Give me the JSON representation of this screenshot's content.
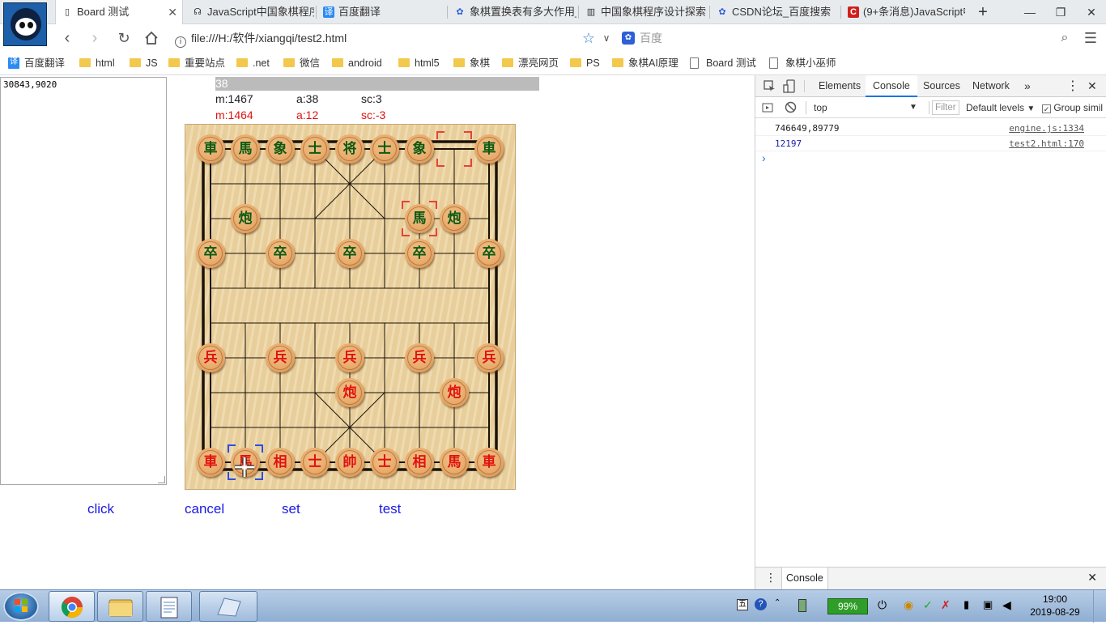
{
  "browser": {
    "tabs": [
      {
        "label": "Board 测试",
        "icon": "doc-icon",
        "active": true
      },
      {
        "label": "JavaScript中国象棋程序",
        "icon": "code-icon"
      },
      {
        "label": "百度翻译",
        "icon": "translate-icon"
      },
      {
        "label": "象棋置换表有多大作用_",
        "icon": "baidu-paw-icon"
      },
      {
        "label": "中国象棋程序设计探索",
        "icon": "book-icon"
      },
      {
        "label": "CSDN论坛_百度搜索",
        "icon": "baidu-paw-icon"
      },
      {
        "label": "(9+条消息)JavaScript中",
        "icon": "csdn-icon"
      }
    ],
    "new_tab": "+",
    "window_controls": {
      "minimize": "—",
      "maximize": "❐",
      "close": "✕"
    },
    "url": "file:///H:/软件/xiangqi/test2.html",
    "search_placeholder": "百度",
    "bookmarks": [
      {
        "label": "百度翻译",
        "icon": "translate-icon"
      },
      {
        "label": "html",
        "icon": "folder-icon"
      },
      {
        "label": "JS",
        "icon": "folder-icon"
      },
      {
        "label": "重要站点",
        "icon": "folder-icon"
      },
      {
        "label": ".net",
        "icon": "folder-icon"
      },
      {
        "label": "微信",
        "icon": "folder-icon"
      },
      {
        "label": "android",
        "icon": "folder-icon"
      },
      {
        "label": "html5",
        "icon": "folder-icon"
      },
      {
        "label": "象棋",
        "icon": "folder-icon"
      },
      {
        "label": "漂亮网页",
        "icon": "folder-icon"
      },
      {
        "label": "PS",
        "icon": "folder-icon"
      },
      {
        "label": "象棋AI原理",
        "icon": "folder-icon"
      },
      {
        "label": "Board 测试",
        "icon": "doc-icon"
      },
      {
        "label": "象棋小巫师",
        "icon": "doc-icon"
      }
    ]
  },
  "page": {
    "textarea_value": "30843,9020",
    "progress_label": "38",
    "stats_black": {
      "m": "m:1467",
      "a": "a:38",
      "sc": "sc:3"
    },
    "stats_red": {
      "m": "m:1464",
      "a": "a:12",
      "sc": "sc:-3"
    },
    "colors": {
      "red": "#e0120e",
      "black": "#0d5a12",
      "link": "#1a1ae6",
      "board": "#ecd3a0"
    },
    "links": [
      "click",
      "cancel",
      "set",
      "test"
    ],
    "pieces": [
      {
        "ch": "車",
        "side": "black",
        "col": 0,
        "row": 0
      },
      {
        "ch": "馬",
        "side": "black",
        "col": 1,
        "row": 0
      },
      {
        "ch": "象",
        "side": "black",
        "col": 2,
        "row": 0
      },
      {
        "ch": "士",
        "side": "black",
        "col": 3,
        "row": 0
      },
      {
        "ch": "将",
        "side": "black",
        "col": 4,
        "row": 0
      },
      {
        "ch": "士",
        "side": "black",
        "col": 5,
        "row": 0
      },
      {
        "ch": "象",
        "side": "black",
        "col": 6,
        "row": 0
      },
      {
        "ch": "車",
        "side": "black",
        "col": 8,
        "row": 0
      },
      {
        "ch": "炮",
        "side": "black",
        "col": 1,
        "row": 2
      },
      {
        "ch": "馬",
        "side": "black",
        "col": 6,
        "row": 2
      },
      {
        "ch": "炮",
        "side": "black",
        "col": 7,
        "row": 2
      },
      {
        "ch": "卒",
        "side": "black",
        "col": 0,
        "row": 3
      },
      {
        "ch": "卒",
        "side": "black",
        "col": 2,
        "row": 3
      },
      {
        "ch": "卒",
        "side": "black",
        "col": 4,
        "row": 3
      },
      {
        "ch": "卒",
        "side": "black",
        "col": 6,
        "row": 3
      },
      {
        "ch": "卒",
        "side": "black",
        "col": 8,
        "row": 3
      },
      {
        "ch": "兵",
        "side": "red",
        "col": 0,
        "row": 6
      },
      {
        "ch": "兵",
        "side": "red",
        "col": 2,
        "row": 6
      },
      {
        "ch": "兵",
        "side": "red",
        "col": 4,
        "row": 6
      },
      {
        "ch": "兵",
        "side": "red",
        "col": 6,
        "row": 6
      },
      {
        "ch": "兵",
        "side": "red",
        "col": 8,
        "row": 6
      },
      {
        "ch": "炮",
        "side": "red",
        "col": 4,
        "row": 7
      },
      {
        "ch": "炮",
        "side": "red",
        "col": 7,
        "row": 7
      },
      {
        "ch": "車",
        "side": "red",
        "col": 0,
        "row": 9
      },
      {
        "ch": "馬",
        "side": "red",
        "col": 1,
        "row": 9
      },
      {
        "ch": "相",
        "side": "red",
        "col": 2,
        "row": 9
      },
      {
        "ch": "士",
        "side": "red",
        "col": 3,
        "row": 9
      },
      {
        "ch": "帥",
        "side": "red",
        "col": 4,
        "row": 9
      },
      {
        "ch": "士",
        "side": "red",
        "col": 5,
        "row": 9
      },
      {
        "ch": "相",
        "side": "red",
        "col": 6,
        "row": 9
      },
      {
        "ch": "馬",
        "side": "red",
        "col": 7,
        "row": 9
      },
      {
        "ch": "車",
        "side": "red",
        "col": 8,
        "row": 9
      }
    ],
    "selections": [
      {
        "col": 7,
        "row": 0,
        "color": "#e8413a"
      },
      {
        "col": 6,
        "row": 2,
        "color": "#e8413a"
      },
      {
        "col": 1,
        "row": 9,
        "color": "#2b4fe0"
      }
    ]
  },
  "devtools": {
    "tabs": [
      "Elements",
      "Console",
      "Sources",
      "Network",
      "»"
    ],
    "active_tab": "Console",
    "context": "top",
    "filter_placeholder": "Filter",
    "levels": "Default levels",
    "group_similar": "Group simil",
    "messages": [
      {
        "text": "746649,89779",
        "source": "engine.js:1334",
        "color": "#222222"
      },
      {
        "text": "12197",
        "source": "test2.html:170",
        "color": "#1a1aa6"
      }
    ],
    "prompt": "›",
    "drawer_tab": "Console"
  },
  "taskbar": {
    "battery": "99%",
    "ime": "五",
    "clock_time": "19:00",
    "clock_date": "2019-08-29"
  }
}
